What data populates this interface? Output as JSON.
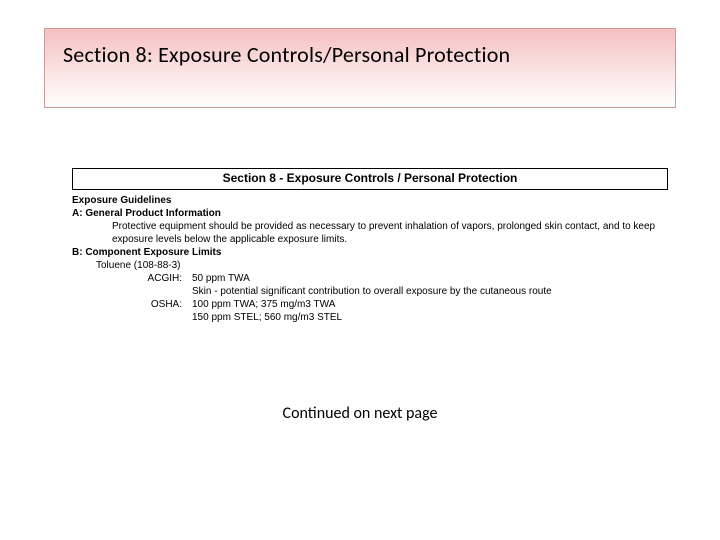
{
  "banner": {
    "title": "Section 8: Exposure Controls/Personal Protection"
  },
  "sds": {
    "sectionHeader": "Section 8 - Exposure Controls / Personal Protection",
    "exposureGuidelinesLabel": "Exposure Guidelines",
    "partA": {
      "label": "A: General Product Information",
      "text1": "Protective equipment should be provided as necessary to prevent inhalation of vapors, prolonged skin contact, and to keep",
      "text2": "exposure levels below the applicable exposure limits."
    },
    "partB": {
      "label": "B: Component Exposure Limits",
      "component": "Toluene  (108-88-3)",
      "rows": {
        "acgihLabel": "ACGIH:",
        "acgihVal1": "50 ppm TWA",
        "acgihVal2": "Skin - potential significant contribution to overall exposure by the cutaneous route",
        "oshaLabel": "OSHA:",
        "oshaVal1": "100 ppm TWA; 375 mg/m3 TWA",
        "oshaVal2": "150 ppm STEL; 560 mg/m3 STEL"
      }
    }
  },
  "footer": {
    "continued": "Continued on next page"
  }
}
